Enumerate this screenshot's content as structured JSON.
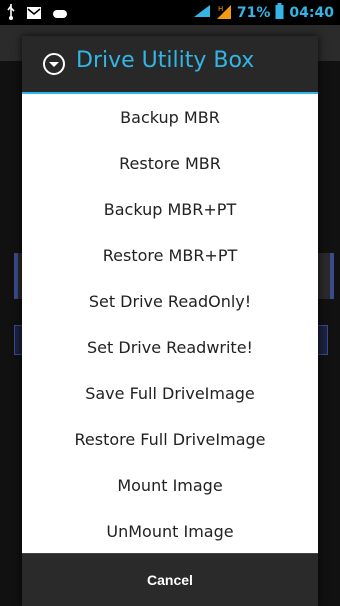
{
  "status_bar": {
    "battery_percent": "71%",
    "time": "04:40",
    "icons": [
      "usb-icon",
      "email-icon",
      "gamepad-icon",
      "wifi-icon",
      "signal-icon",
      "battery-icon"
    ]
  },
  "dialog": {
    "title": "Drive Utility Box",
    "items": [
      {
        "label": "Backup MBR"
      },
      {
        "label": "Restore MBR"
      },
      {
        "label": "Backup MBR+PT"
      },
      {
        "label": "Restore MBR+PT"
      },
      {
        "label": "Set Drive ReadOnly!"
      },
      {
        "label": "Set Drive Readwrite!"
      },
      {
        "label": "Save Full DriveImage"
      },
      {
        "label": "Restore Full DriveImage"
      },
      {
        "label": "Mount Image"
      },
      {
        "label": "UnMount Image"
      }
    ],
    "cancel_label": "Cancel"
  },
  "colors": {
    "accent": "#33b5e5",
    "header_bg": "#282828"
  }
}
